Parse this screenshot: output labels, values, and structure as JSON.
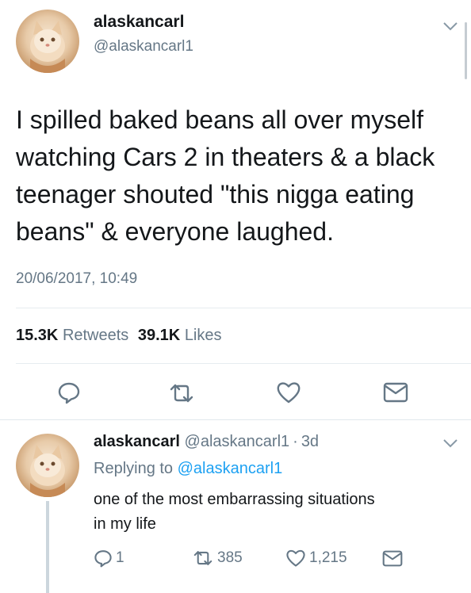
{
  "tweet": {
    "display_name": "alaskancarl",
    "handle": "@alaskancarl1",
    "text_lines": [
      "I spilled baked beans all over myself",
      "watching Cars 2 in theaters & a black",
      "teenager shouted \"this nigga eating",
      "beans\" & everyone laughed."
    ],
    "timestamp": "20/06/2017, 10:49",
    "stats": {
      "retweets_count": "15.3K",
      "retweets_label": "Retweets",
      "likes_count": "39.1K",
      "likes_label": "Likes"
    },
    "actions": [
      "reply-icon",
      "retweet-icon",
      "like-icon",
      "message-icon"
    ],
    "caret_icon": "chevron-down-icon"
  },
  "reply": {
    "display_name": "alaskancarl",
    "handle": "@alaskancarl1",
    "separator": "·",
    "time": "3d",
    "replying_prefix": "Replying to",
    "replying_handle": "@alaskancarl1",
    "text_lines": [
      "one of the most embarrassing situations",
      "in my life"
    ],
    "counts": {
      "reply": "1",
      "retweet": "385",
      "like": "1,215"
    }
  },
  "colors": {
    "link_blue": "#1da1f2",
    "muted_gray": "#657786",
    "divider": "#e6ecf0",
    "text": "#14171a"
  }
}
